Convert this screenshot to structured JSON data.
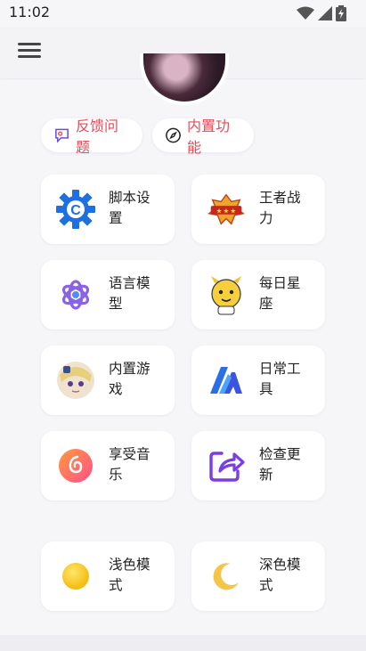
{
  "status_bar": {
    "time": "11:02"
  },
  "pills": [
    {
      "label": "反馈问题",
      "icon": "feedback-icon"
    },
    {
      "label": "内置功能",
      "icon": "compass-icon"
    }
  ],
  "cards": [
    {
      "label": "脚本设置",
      "icon": "script-settings-gear-icon"
    },
    {
      "label": "王者战力",
      "icon": "honor-of-kings-logo-icon"
    },
    {
      "label": "语言模型",
      "icon": "language-model-icon"
    },
    {
      "label": "每日星座",
      "icon": "daily-horoscope-icon"
    },
    {
      "label": "内置游戏",
      "icon": "built-in-game-icon"
    },
    {
      "label": "日常工具",
      "icon": "daily-tools-icon"
    },
    {
      "label": "享受音乐",
      "icon": "music-icon"
    },
    {
      "label": "检查更新",
      "icon": "update-share-icon"
    },
    {
      "label": "浅色模式",
      "icon": "light-mode-icon"
    },
    {
      "label": "深色模式",
      "icon": "dark-mode-icon"
    }
  ],
  "colors": {
    "accent": "#e84a55",
    "background": "#f6f6f9"
  }
}
